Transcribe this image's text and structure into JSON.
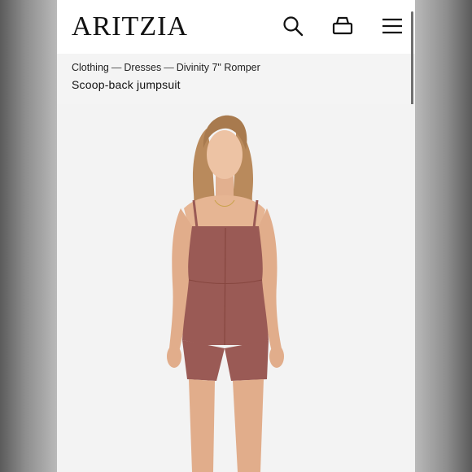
{
  "header": {
    "logo": "ARITZIA",
    "icons": [
      "search-icon",
      "bag-icon",
      "menu-icon"
    ]
  },
  "breadcrumb": {
    "items": [
      "Clothing",
      "Dresses",
      "Divinity 7\" Romper"
    ],
    "separator": "—"
  },
  "product": {
    "title": "Scoop-back jumpsuit"
  },
  "colors": {
    "romper": "#9a5a55",
    "background": "#f4f4f4",
    "text": "#111111"
  }
}
